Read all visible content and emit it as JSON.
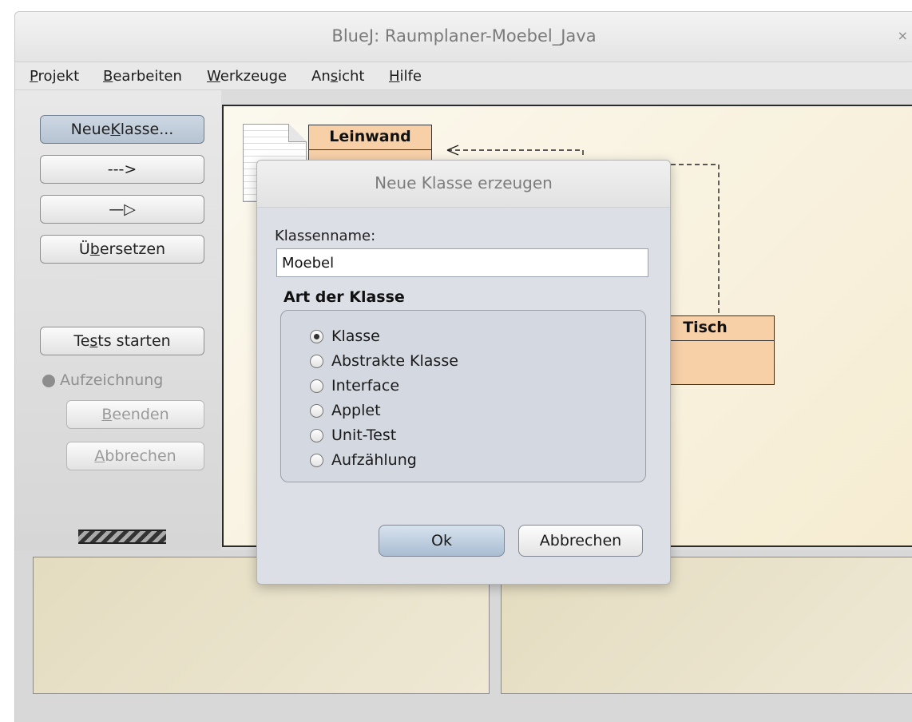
{
  "window": {
    "title": "BlueJ:  Raumplaner-Moebel_Java",
    "close_glyph": "×"
  },
  "menu": {
    "items": [
      {
        "pre": "",
        "mnemonic": "P",
        "post": "rojekt"
      },
      {
        "pre": "",
        "mnemonic": "B",
        "post": "earbeiten"
      },
      {
        "pre": "",
        "mnemonic": "W",
        "post": "erkzeuge"
      },
      {
        "pre": "An",
        "mnemonic": "s",
        "post": "icht"
      },
      {
        "pre": "",
        "mnemonic": "H",
        "post": "ilfe"
      }
    ]
  },
  "toolbar": {
    "new_class": {
      "pre": "Neue ",
      "mnemonic": "K",
      "post": "lasse..."
    },
    "dependency_arrow": "--->",
    "inheritance_arrow": "—▷",
    "compile": {
      "pre": "Ü",
      "mnemonic": "b",
      "post": "ersetzen"
    },
    "run_tests": {
      "pre": "Te",
      "mnemonic": "s",
      "post": "ts starten"
    },
    "recording_label": "Aufzeichnung",
    "end": {
      "pre": "",
      "mnemonic": "B",
      "post": "eenden"
    },
    "abort": {
      "pre": "",
      "mnemonic": "A",
      "post": "bbrechen"
    }
  },
  "diagram": {
    "classes": [
      "Leinwand",
      "Tisch"
    ]
  },
  "dialog": {
    "title": "Neue Klasse erzeugen",
    "name_label": "Klassenname:",
    "name_value": "Moebel",
    "group_title": "Art der Klasse",
    "options": [
      {
        "label": "Klasse",
        "checked": true
      },
      {
        "label": "Abstrakte Klasse",
        "checked": false
      },
      {
        "label": "Interface",
        "checked": false
      },
      {
        "label": "Applet",
        "checked": false
      },
      {
        "label": "Unit-Test",
        "checked": false
      },
      {
        "label": "Aufzählung",
        "checked": false
      }
    ],
    "ok_label": "Ok",
    "cancel_label": "Abbrechen"
  }
}
